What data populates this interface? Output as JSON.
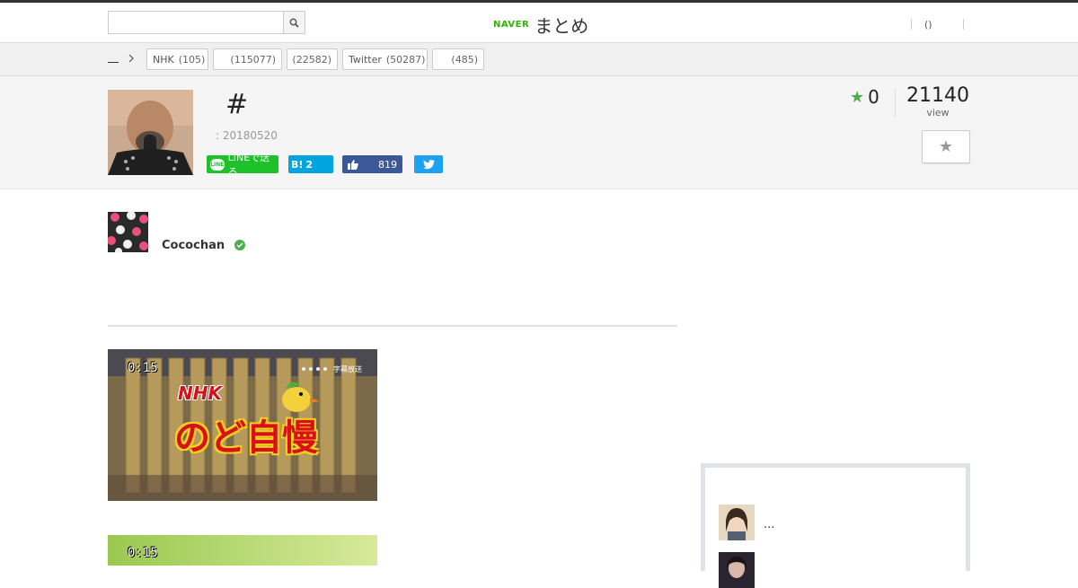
{
  "header": {
    "search_placeholder": "",
    "logo_naver": "NAVER",
    "logo_matome": "まとめ",
    "user_paren": "()"
  },
  "breadcrumb": {
    "home": ""
  },
  "tags": [
    {
      "label": "NHK",
      "count": "(105)"
    },
    {
      "label": "",
      "count": "(115077)"
    },
    {
      "label": "",
      "count": "(22582)"
    },
    {
      "label": "Twitter",
      "count": "(50287)"
    },
    {
      "label": "",
      "count": "(485)"
    }
  ],
  "article": {
    "title": "#",
    "date": ": 20180520",
    "favorites": "0",
    "views": "21140",
    "views_label": "view"
  },
  "share": {
    "line_label": "LINEで送る",
    "hatena_label": "B!",
    "hatena_count": "2",
    "facebook_count": "819"
  },
  "author": {
    "name": "Cocochan"
  },
  "videos": [
    {
      "time": "0:15",
      "caption_badge": "字幕放送",
      "logo_nhk": "NHK",
      "logo_title": "のど自慢"
    },
    {
      "time": "0:15"
    }
  ],
  "sidebar": {
    "items": [
      {
        "text": "..."
      },
      {
        "text": ""
      }
    ]
  },
  "colors": {
    "naver_green": "#2db400",
    "line_green": "#1dc12a",
    "hatena_blue": "#00a4de",
    "facebook_blue": "#3b5998",
    "twitter_blue": "#1da1f2",
    "star_green": "#4cae4c"
  }
}
